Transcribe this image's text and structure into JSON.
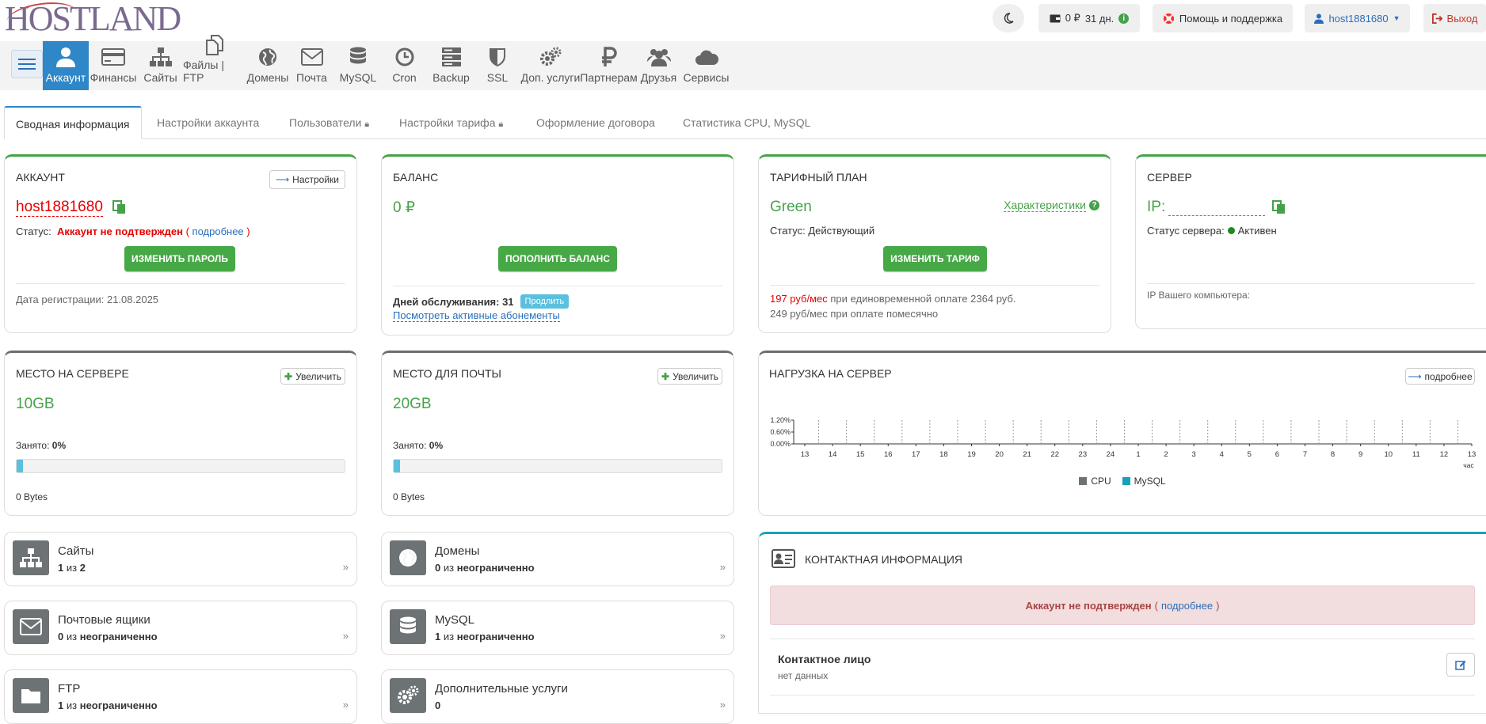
{
  "header": {
    "logo": "HOSTLAND",
    "wallet_balance": "0 ₽",
    "wallet_days": "31 дн.",
    "help": "Помощь и поддержка",
    "user": "host1881680",
    "logout": "Выход"
  },
  "nav": {
    "items": [
      {
        "label": "Аккаунт",
        "icon": "user-icon"
      },
      {
        "label": "Финансы",
        "icon": "credit-card-icon"
      },
      {
        "label": "Сайты",
        "icon": "sitemap-icon"
      },
      {
        "label": "Файлы | FTP",
        "icon": "files-icon"
      },
      {
        "label": "Домены",
        "icon": "globe-icon"
      },
      {
        "label": "Почта",
        "icon": "envelope-icon"
      },
      {
        "label": "MySQL",
        "icon": "database-icon"
      },
      {
        "label": "Cron",
        "icon": "clock-icon"
      },
      {
        "label": "Backup",
        "icon": "server-icon"
      },
      {
        "label": "SSL",
        "icon": "shield-icon"
      },
      {
        "label": "Доп. услуги",
        "icon": "gears-icon"
      },
      {
        "label": "Партнерам",
        "icon": "ruble-icon"
      },
      {
        "label": "Друзья",
        "icon": "users-icon"
      },
      {
        "label": "Сервисы",
        "icon": "cloud-icon"
      }
    ]
  },
  "tabs": [
    "Сводная информация",
    "Настройки аккаунта",
    "Пользователи",
    "Настройки тарифа",
    "Оформление договора",
    "Статистика CPU, MySQL"
  ],
  "account": {
    "title": "АККАУНТ",
    "settings_btn": "Настройки",
    "login": "host1881680",
    "status_label": "Статус:",
    "status_value": "Аккаунт не подтвержден",
    "status_link": "подробнее",
    "button": "ИЗМЕНИТЬ ПАРОЛЬ",
    "reg_date": "Дата регистрации: 21.08.2025"
  },
  "balance": {
    "title": "БАЛАНС",
    "value": "0 ₽",
    "button": "ПОПОЛНИТЬ БАЛАНС",
    "days_label": "Дней обслуживания: 31",
    "extend": "Продлить",
    "subscriptions": "Посмотреть активные абонементы"
  },
  "tariff": {
    "title": "ТАРИФНЫЙ ПЛАН",
    "name": "Green",
    "specs": "Характеристики",
    "status": "Статус: Действующий",
    "button": "ИЗМЕНИТЬ ТАРИФ",
    "price1": "197 руб/мес",
    "price1_note": "при единовременной оплате 2364 руб.",
    "price2": "249 руб/мес при оплате помесячно"
  },
  "server": {
    "title": "СЕРВЕР",
    "ip_label": "IP:",
    "status_label": "Статус сервера:",
    "status_value": "Активен",
    "your_ip": "IP Вашего компьютера:"
  },
  "disk": {
    "title": "МЕСТО НА СЕРВЕРЕ",
    "increase": "Увеличить",
    "value": "10GB",
    "used_label": "Занято:",
    "used_value": "0%",
    "used_fraction": 0,
    "bytes": "0 Bytes"
  },
  "mail_space": {
    "title": "МЕСТО ДЛЯ ПОЧТЫ",
    "increase": "Увеличить",
    "value": "20GB",
    "used_label": "Занято:",
    "used_value": "0%",
    "used_fraction": 0,
    "bytes": "0 Bytes"
  },
  "load": {
    "title": "НАГРУЗКА НА СЕРВЕР",
    "details": "подробнее"
  },
  "chart_data": {
    "type": "line",
    "yticks": [
      "1.20%",
      "0.60%",
      "0.00%"
    ],
    "ylim": [
      0,
      1.2
    ],
    "categories": [
      "13",
      "14",
      "15",
      "16",
      "17",
      "18",
      "19",
      "20",
      "21",
      "22",
      "23",
      "24",
      "1",
      "2",
      "3",
      "4",
      "5",
      "6",
      "7",
      "8",
      "9",
      "10",
      "11",
      "12",
      "13"
    ],
    "xunit": "час",
    "series": [
      {
        "name": "CPU",
        "color": "#6d7275",
        "values": []
      },
      {
        "name": "MySQL",
        "color": "#17a2b8",
        "values": []
      }
    ]
  },
  "stats": [
    {
      "name": "Сайты",
      "used": "1",
      "sep": "из",
      "total": "2",
      "icon": "sitemap-icon"
    },
    {
      "name": "Домены",
      "used": "0",
      "sep": "из",
      "total": "неограниченно",
      "icon": "globe-icon"
    },
    {
      "name": "Почтовые ящики",
      "used": "0",
      "sep": "из",
      "total": "неограниченно",
      "icon": "envelope-icon"
    },
    {
      "name": "MySQL",
      "used": "1",
      "sep": "из",
      "total": "неограниченно",
      "icon": "database-icon"
    },
    {
      "name": "FTP",
      "used": "1",
      "sep": "из",
      "total": "неограниченно",
      "icon": "folder-icon"
    },
    {
      "name": "Дополнительные услуги",
      "used": "0",
      "sep": "",
      "total": "",
      "icon": "gears-icon"
    }
  ],
  "contact": {
    "title": "КОНТАКТНАЯ ИНФОРМАЦИЯ",
    "alert": "Аккаунт не подтвержден",
    "alert_link": "подробнее",
    "person_label": "Контактное лицо",
    "person_value": "нет данных"
  }
}
